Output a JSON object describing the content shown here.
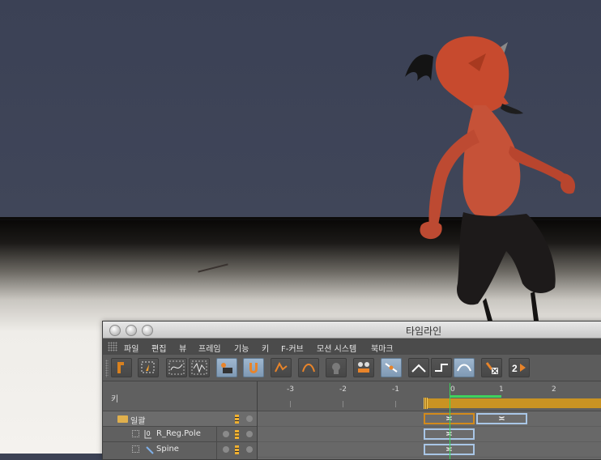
{
  "window": {
    "title": "타임라인"
  },
  "menu": [
    "파일",
    "편집",
    "뷰",
    "프레임",
    "기능",
    "키",
    "F-커브",
    "모션 시스템",
    "북마크"
  ],
  "toolbar": {
    "buttons": [
      {
        "name": "record-key-tool",
        "active": false
      },
      {
        "name": "edit-tool",
        "active": false
      },
      {
        "name": "fcurve-tool",
        "active": false
      },
      {
        "name": "fcurve-alt-tool",
        "active": false
      },
      {
        "name": "link-view-tool",
        "active": true
      },
      {
        "name": "magnet-tool",
        "active": true
      },
      {
        "name": "snap-tool",
        "active": false
      },
      {
        "name": "interp-tool",
        "active": false
      },
      {
        "name": "ghost-tool",
        "active": false
      },
      {
        "name": "ruler-tool",
        "active": false
      },
      {
        "name": "auto-tangent-tool",
        "active": true
      },
      {
        "name": "linear-tool",
        "active": false
      },
      {
        "name": "step-tool",
        "active": false
      },
      {
        "name": "spline-tool",
        "active": true
      },
      {
        "name": "delete-key-tool",
        "active": false
      },
      {
        "name": "double-key-tool",
        "active": false
      }
    ]
  },
  "panel": {
    "key_header": "키",
    "ruler_labels": [
      "-3",
      "-2",
      "-1",
      "0",
      "1",
      "2"
    ],
    "tracks": [
      {
        "label": "일괄",
        "type": "folder"
      },
      {
        "label": "R_Reg.Pole",
        "type": "null"
      },
      {
        "label": "Spine",
        "type": "bone"
      }
    ]
  },
  "colors": {
    "accent_key_orange": "#d28a1c",
    "key_blue": "#a9c6e6",
    "playhead_green": "#38d45a",
    "range_gold": "#c99323"
  }
}
